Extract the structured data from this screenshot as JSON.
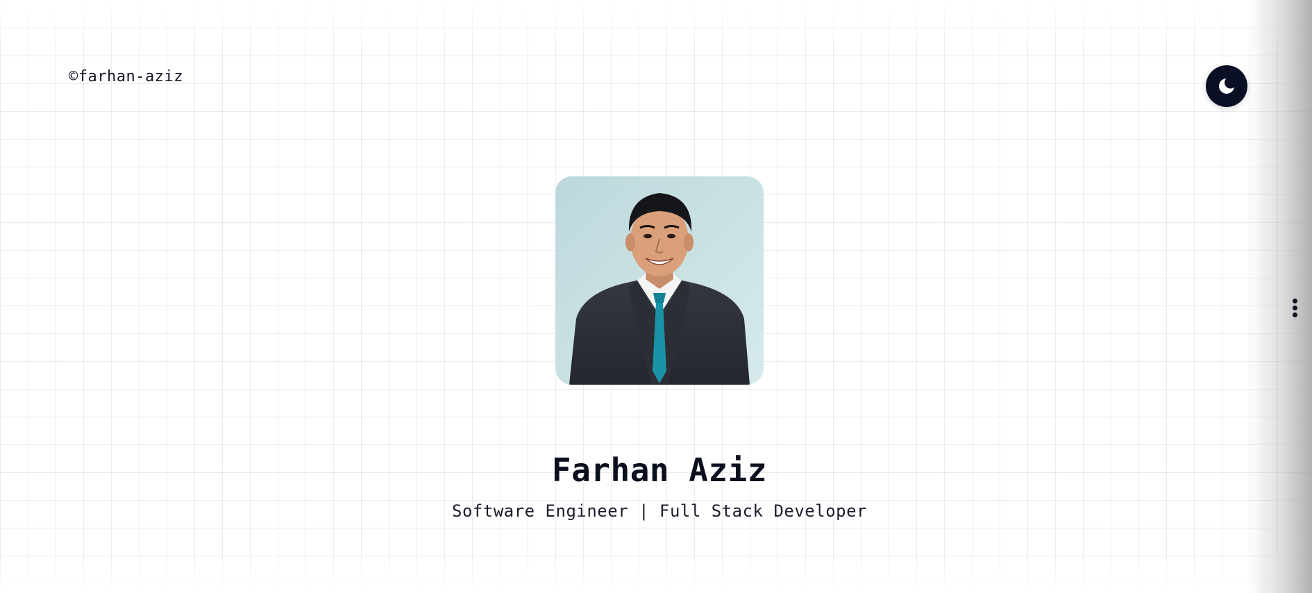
{
  "header": {
    "copyright": "©farhan-aziz"
  },
  "theme_toggle": {
    "icon": "moon-icon",
    "background": "#0a0f24"
  },
  "side_menu": {
    "icon": "vertical-dots-icon"
  },
  "profile": {
    "photo_alt": "Farhan Aziz",
    "name": "Farhan Aziz",
    "title": "Software Engineer | Full Stack Developer"
  },
  "colors": {
    "text": "#0b0f1e",
    "photo_background": "#c9e1e3",
    "suit": "#2a2d33",
    "tie": "#1a93a6"
  }
}
